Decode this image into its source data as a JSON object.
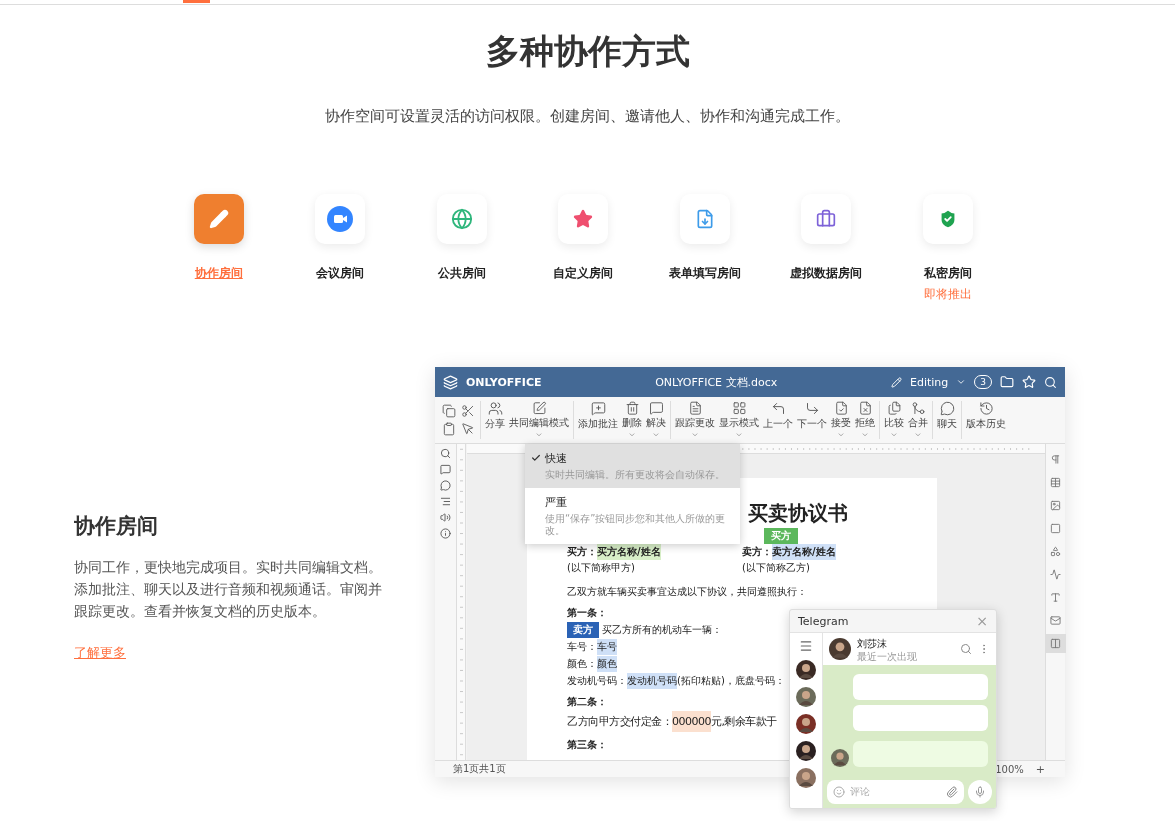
{
  "header": {
    "title": "多种协作方式",
    "subtitle": "协作空间可设置灵活的访问权限。创建房间、邀请他人、协作和沟通完成工作。"
  },
  "room_tabs": [
    {
      "label": "协作房间",
      "selected": true
    },
    {
      "label": "会议房间",
      "selected": false
    },
    {
      "label": "公共房间",
      "selected": false
    },
    {
      "label": "自定义房间",
      "selected": false
    },
    {
      "label": "表单填写房间",
      "selected": false
    },
    {
      "label": "虚拟数据房间",
      "selected": false
    },
    {
      "label": "私密房间",
      "selected": false,
      "note": "即将推出"
    }
  ],
  "feature": {
    "title": "协作房间",
    "description": "协同工作，更快地完成项目。实时共同编辑文档。添加批注、聊天以及进行音频和视频通话。审阅并跟踪更改。查看并恢复文档的历史版本。",
    "link": "了解更多"
  },
  "editor": {
    "logo": "ONLYOFFICE",
    "title": "ONLYOFFICE 文档.docx",
    "mode": "Editing",
    "user_count": "3",
    "toolbar": [
      [
        {
          "label": "分享",
          "has_menu": false
        },
        {
          "label": "共同编辑模式",
          "has_menu": true
        }
      ],
      [
        {
          "label": "添加批注",
          "has_menu": false
        },
        {
          "label": "删除",
          "has_menu": true
        },
        {
          "label": "解决",
          "has_menu": true
        }
      ],
      [
        {
          "label": "跟踪更改",
          "has_menu": true
        },
        {
          "label": "显示模式",
          "has_menu": true
        },
        {
          "label": "上一个",
          "has_menu": false
        },
        {
          "label": "下一个",
          "has_menu": false
        },
        {
          "label": "接受",
          "has_menu": true
        },
        {
          "label": "拒绝",
          "has_menu": true
        }
      ],
      [
        {
          "label": "比较",
          "has_menu": true
        },
        {
          "label": "合并",
          "has_menu": true
        }
      ],
      [
        {
          "label": "聊天",
          "has_menu": false
        }
      ],
      [
        {
          "label": "版本历史",
          "has_menu": false
        }
      ]
    ],
    "coedit_menu": [
      {
        "label": "快速",
        "description": "实时共同编辑。所有更改将会自动保存。",
        "selected": true
      },
      {
        "label": "严重",
        "description": "使用“保存”按钮同步您和其他人所做的更改。",
        "selected": false
      }
    ],
    "right_panel": [
      {
        "selected": false
      },
      {
        "selected": false
      },
      {
        "selected": false
      },
      {
        "selected": false
      },
      {
        "selected": false
      },
      {
        "selected": false
      },
      {
        "selected": false
      },
      {
        "selected": false
      },
      {
        "selected": true
      }
    ],
    "document": {
      "title": "买卖协议书",
      "buyer": {
        "label": "买方：",
        "field": "买方名称/姓名",
        "note": "(以下简称甲方)"
      },
      "seller": {
        "label": "卖方：",
        "field": "卖方名称/姓名",
        "note": "(以下简称乙方)",
        "cursor": {
          "label": "买方",
          "color": "#5cb85c"
        }
      },
      "lines": [
        {
          "kind": "plain",
          "parts": [
            {
              "text": "乙双方就车辆买卖事宜达成以下协议，共同遵照执行："
            }
          ]
        },
        {
          "kind": "heading",
          "parts": [
            {
              "text": "第一条："
            }
          ]
        },
        {
          "kind": "plain",
          "cursor": {
            "label": "卖方",
            "color": "#2a62b5"
          },
          "parts": [
            {
              "text": "买乙方所有的机动车一辆："
            }
          ]
        },
        {
          "kind": "plain",
          "parts": [
            {
              "text": "车号："
            },
            {
              "text": "车号",
              "color": "#cfe0f7"
            }
          ]
        },
        {
          "kind": "plain",
          "parts": [
            {
              "text": "颜色："
            },
            {
              "text": "颜色",
              "color": "#cfe0f7"
            }
          ]
        },
        {
          "kind": "plain",
          "parts": [
            {
              "text": "发动机号码："
            },
            {
              "text": "发动机号码",
              "color": "#cfe0f7"
            },
            {
              "text": "(拓印粘贴)，底盘号码："
            }
          ]
        },
        {
          "kind": "heading",
          "parts": [
            {
              "text": "第二条："
            }
          ]
        },
        {
          "kind": "large",
          "parts": [
            {
              "text": "乙方向甲方交付定金："
            },
            {
              "text": "000000",
              "color": "#fbe0cf"
            },
            {
              "text": "元,剩余车款于"
            }
          ]
        },
        {
          "kind": "heading",
          "parts": [
            {
              "text": "第三条："
            }
          ]
        }
      ]
    },
    "status": {
      "page": "第1页共1页",
      "zoom": "100%",
      "zoom_in": "+"
    },
    "telegram": {
      "title": "Telegram",
      "close": "×",
      "contact": "刘莎沫",
      "last_seen": "最近一次出现",
      "placeholder": "评论"
    }
  }
}
